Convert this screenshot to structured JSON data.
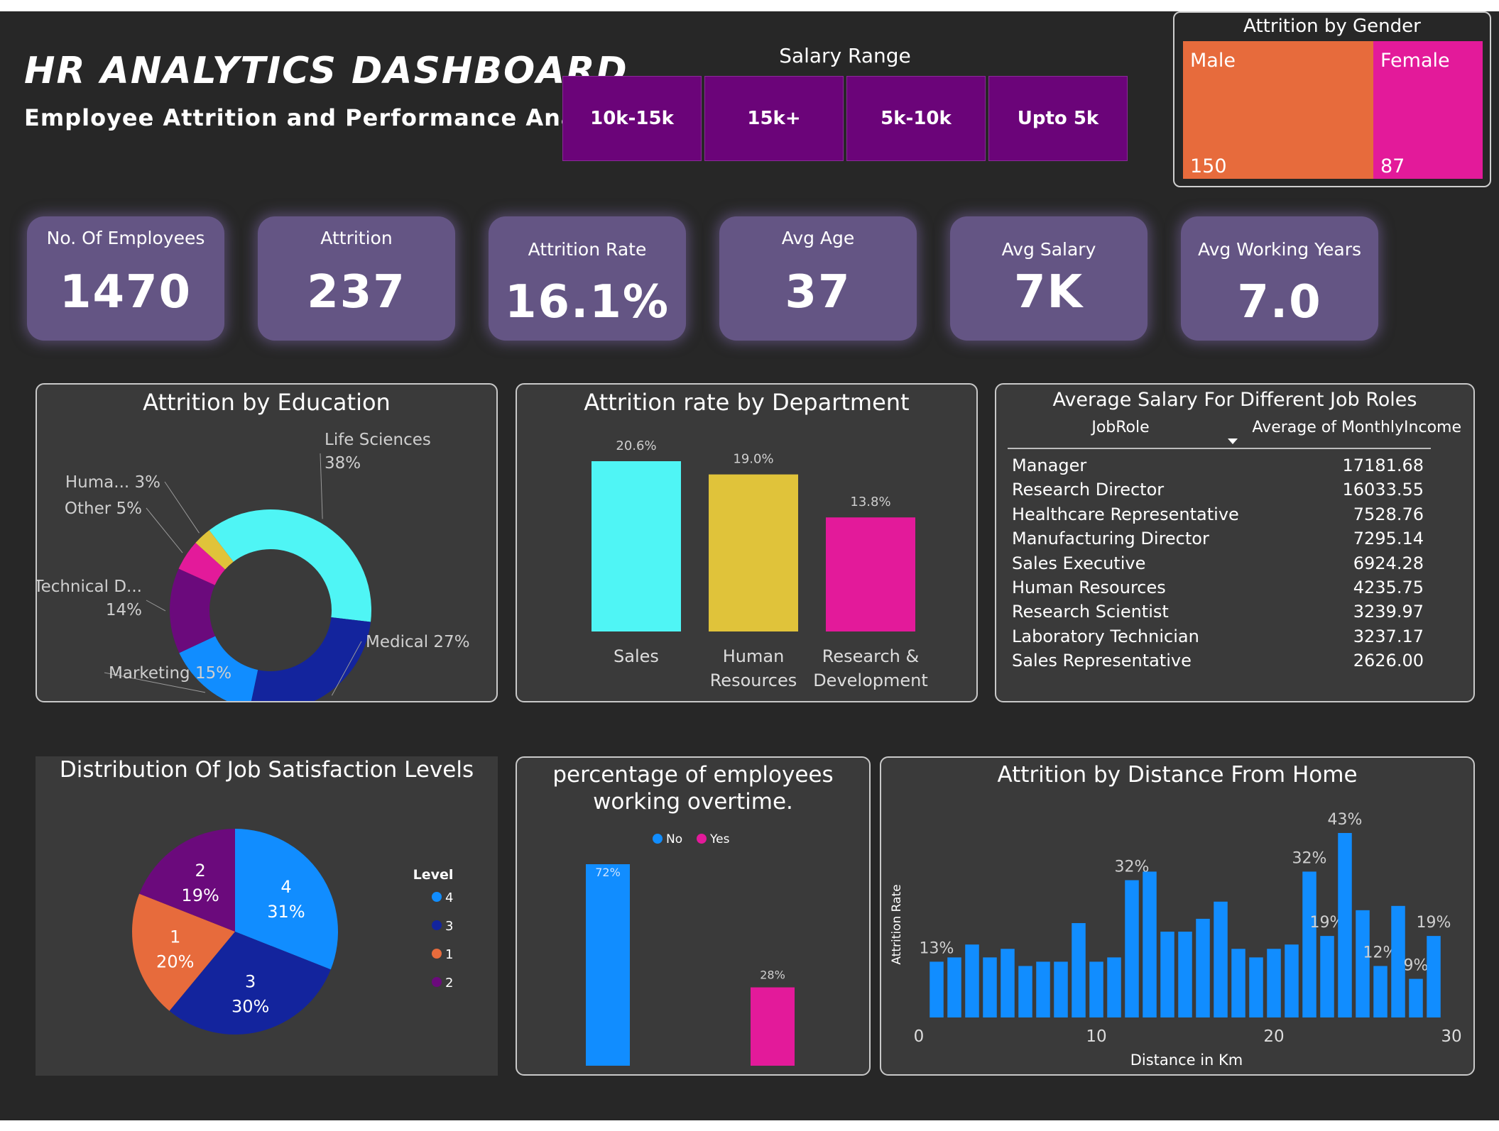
{
  "header": {
    "title": "HR ANALYTICS DASHBOARD",
    "subtitle": "Employee Attrition and Performance Analysis"
  },
  "salary_slicer": {
    "title": "Salary Range",
    "options": [
      "10k-15k",
      "15k+",
      "5k-10k",
      "Upto 5k"
    ]
  },
  "kpis": [
    {
      "label": "No. Of Employees",
      "value": "1470"
    },
    {
      "label": "Attrition",
      "value": "237"
    },
    {
      "label": "Attrition Rate",
      "value": "16.1%"
    },
    {
      "label": "Avg Age",
      "value": "37"
    },
    {
      "label": "Avg Salary",
      "value": "7K"
    },
    {
      "label": "Avg Working Years",
      "value": "7.0"
    }
  ],
  "colors": {
    "background": "#272727",
    "panel": "#3a3a3a",
    "kpi": "#645584",
    "slicer": "#6b0479",
    "cyan": "#4ff5f5",
    "navy": "#13249d",
    "blue": "#118dff",
    "purple": "#6b0a7c",
    "pink": "#e31a9a",
    "yellow": "#e0c33a",
    "orange": "#e76b3c"
  },
  "salary_table": {
    "title": "Average Salary For Different Job Roles",
    "col1": "JobRole",
    "col2": "Average of MonthlyIncome",
    "rows": [
      {
        "role": "Manager",
        "income": "17181.68"
      },
      {
        "role": "Research Director",
        "income": "16033.55"
      },
      {
        "role": "Healthcare Representative",
        "income": "7528.76"
      },
      {
        "role": "Manufacturing Director",
        "income": "7295.14"
      },
      {
        "role": "Sales Executive",
        "income": "6924.28"
      },
      {
        "role": "Human Resources",
        "income": "4235.75"
      },
      {
        "role": "Research Scientist",
        "income": "3239.97"
      },
      {
        "role": "Laboratory Technician",
        "income": "3237.17"
      },
      {
        "role": "Sales Representative",
        "income": "2626.00"
      }
    ]
  },
  "chart_data": [
    {
      "id": "gender",
      "type": "treemap",
      "title": "Attrition by Gender",
      "categories": [
        "Male",
        "Female"
      ],
      "values": [
        150,
        87
      ],
      "colors": [
        "#e76b3c",
        "#e31a9a"
      ]
    },
    {
      "id": "education",
      "type": "pie",
      "donut": true,
      "title": "Attrition by Education",
      "categories": [
        "Life Sciences",
        "Medical",
        "Marketing",
        "Technical D...",
        "Other",
        "Huma..."
      ],
      "values": [
        38,
        27,
        15,
        14,
        5,
        3
      ],
      "labels": [
        "Life Sciences 38%",
        "Medical 27%",
        "Marketing 15%",
        "Technical D... 14%",
        "Other 5%",
        "Huma... 3%"
      ],
      "colors": [
        "#4ff5f5",
        "#13249d",
        "#118dff",
        "#6b0a7c",
        "#e31a9a",
        "#e0c33a"
      ]
    },
    {
      "id": "department",
      "type": "bar",
      "title": "Attrition rate by Department",
      "categories": [
        "Sales",
        "Human Resources",
        "Research & Development"
      ],
      "category_lines": [
        [
          "Sales"
        ],
        [
          "Human",
          "Resources"
        ],
        [
          "Research &",
          "Development"
        ]
      ],
      "values": [
        20.6,
        19.0,
        13.8
      ],
      "labels": [
        "20.6%",
        "19.0%",
        "13.8%"
      ],
      "colors": [
        "#4ff5f5",
        "#e0c33a",
        "#e31a9a"
      ],
      "ylim": [
        0,
        22
      ]
    },
    {
      "id": "satisfaction",
      "type": "pie",
      "title": "Distribution Of Job Satisfaction Levels",
      "legend_title": "Level",
      "legend_position": "right",
      "categories": [
        "4",
        "3",
        "1",
        "2"
      ],
      "values": [
        31,
        30,
        20,
        19
      ],
      "labels": [
        "31%",
        "30%",
        "20%",
        "19%"
      ],
      "colors": [
        "#118dff",
        "#13249d",
        "#e76b3c",
        "#6b0a7c"
      ]
    },
    {
      "id": "overtime",
      "type": "bar",
      "title_lines": [
        "percentage of employees",
        "working overtime."
      ],
      "categories": [
        "No",
        "Yes"
      ],
      "values": [
        72,
        28
      ],
      "labels": [
        "72%",
        "28%"
      ],
      "colors": [
        "#118dff",
        "#e31a9a"
      ],
      "legend_position": "top",
      "ylim": [
        0,
        75
      ]
    },
    {
      "id": "distance",
      "type": "bar",
      "title": "Attrition by Distance From Home",
      "xlabel": "Distance in Km",
      "ylabel": "Attrition Rate",
      "x": [
        1,
        2,
        3,
        4,
        5,
        6,
        7,
        8,
        9,
        10,
        11,
        12,
        13,
        14,
        15,
        16,
        17,
        18,
        19,
        20,
        21,
        22,
        23,
        24,
        25,
        26,
        27,
        28,
        29
      ],
      "values": [
        13,
        14,
        17,
        14,
        16,
        12,
        13,
        13,
        22,
        13,
        14,
        32,
        34,
        20,
        20,
        23,
        27,
        16,
        14,
        16,
        17,
        34,
        19,
        43,
        25,
        12,
        26,
        9,
        19
      ],
      "data_labels": {
        "1": "13%",
        "12": "32%",
        "22": "32%",
        "23": "19%",
        "24": "43%",
        "26": "12%",
        "28": "9%",
        "29": "19%"
      },
      "xticks": [
        0,
        10,
        20,
        30
      ],
      "xlim": [
        0,
        30
      ],
      "ylim": [
        0,
        45
      ],
      "color": "#118dff"
    }
  ]
}
